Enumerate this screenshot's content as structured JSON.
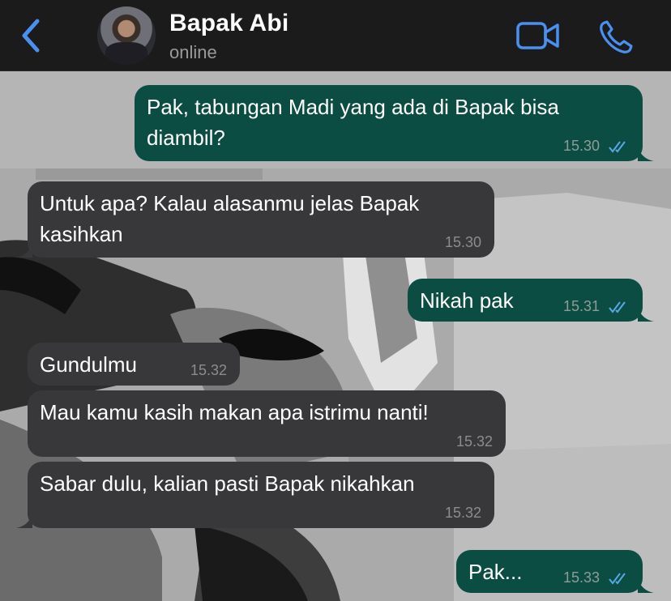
{
  "header": {
    "contact_name": "Bapak Abi",
    "status": "online",
    "back_icon": "chevron-left-icon",
    "video_icon": "video-call-icon",
    "call_icon": "phone-icon",
    "accent_color": "#4a90f0"
  },
  "messages": [
    {
      "direction": "outgoing",
      "text": "Pak, tabungan Madi yang ada di Bapak bisa\ndiambil?",
      "time": "15.30",
      "read": true
    },
    {
      "direction": "incoming",
      "text": "Untuk apa? Kalau alasanmu jelas Bapak\nkasihkan",
      "time": "15.30"
    },
    {
      "direction": "outgoing",
      "text": "Nikah pak",
      "time": "15.31",
      "read": true
    },
    {
      "direction": "incoming",
      "text": "Gundulmu",
      "time": "15.32"
    },
    {
      "direction": "incoming",
      "text": "Mau kamu kasih makan apa istrimu nanti!",
      "time": "15.32"
    },
    {
      "direction": "incoming",
      "text": "Sabar dulu, kalian pasti Bapak nikahkan",
      "time": "15.32"
    },
    {
      "direction": "outgoing",
      "text": "Pak...",
      "time": "15.33",
      "read": true
    }
  ],
  "colors": {
    "outgoing_bubble": "#0b4d42",
    "incoming_bubble": "#38383b",
    "read_ticks": "#5aa7e8"
  }
}
